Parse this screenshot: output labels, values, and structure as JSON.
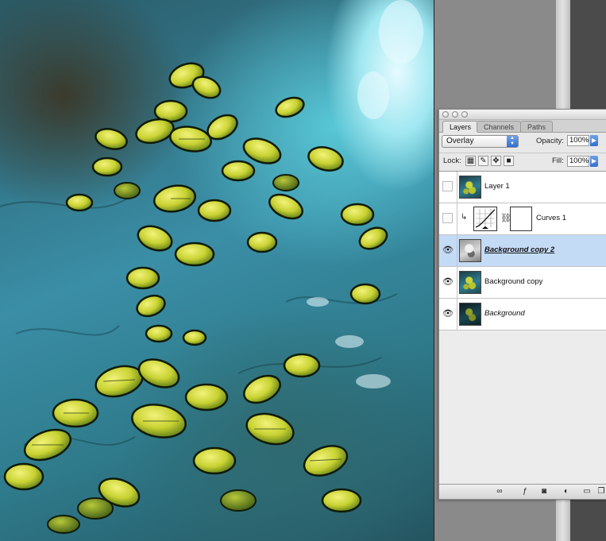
{
  "palette": {
    "tabs": [
      "Layers",
      "Channels",
      "Paths"
    ],
    "blend_mode": "Overlay",
    "opacity_label": "Opacity:",
    "opacity_value": "100%",
    "lock_label": "Lock:",
    "fill_label": "Fill:",
    "fill_value": "100%",
    "layers": [
      {
        "name": "Layer 1",
        "visible": false,
        "selected": false
      },
      {
        "name": "Curves 1",
        "visible": false,
        "selected": false
      },
      {
        "name": "Background copy 2",
        "visible": true,
        "selected": true
      },
      {
        "name": "Background copy",
        "visible": true,
        "selected": false
      },
      {
        "name": "Background",
        "visible": true,
        "selected": false
      }
    ]
  },
  "colors": {
    "selection": "#c4dbf6",
    "accent_blue": "#2f6fcf"
  }
}
